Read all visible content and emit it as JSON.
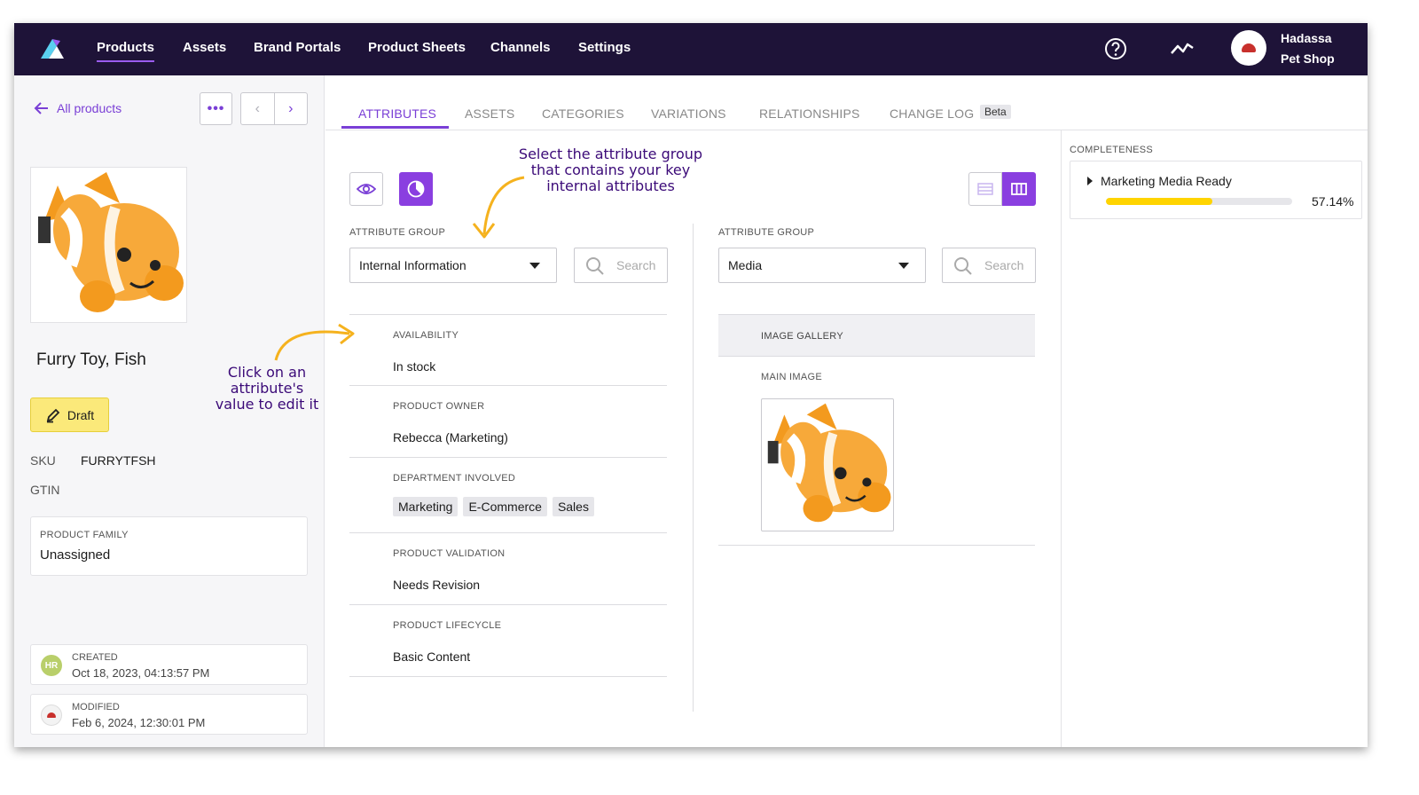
{
  "nav": {
    "items": [
      "Products",
      "Assets",
      "Brand Portals",
      "Product Sheets",
      "Channels",
      "Settings"
    ],
    "user_line1": "Hadassa",
    "user_line2": "Pet Shop"
  },
  "left": {
    "back_label": "All products",
    "more_label": "•••",
    "prev_label": "‹",
    "next_label": "›",
    "product_name": "Furry Toy, Fish",
    "status_label": "Draft",
    "sku_label": "SKU",
    "sku_value": "FURRYTFSH",
    "gtin_label": "GTIN",
    "family_label": "PRODUCT FAMILY",
    "family_value": "Unassigned",
    "created_initials": "HR",
    "created_label": "CREATED",
    "created_value": "Oct 18, 2023, 04:13:57 PM",
    "modified_label": "MODIFIED",
    "modified_value": "Feb 6, 2024, 12:30:01 PM"
  },
  "annotations": {
    "click_line1": "Click on an",
    "click_line2": "attribute's",
    "click_line3": "value to edit it",
    "select_line1": "Select the attribute group",
    "select_line2": "that contains your key",
    "select_line3": "internal attributes"
  },
  "tabs": {
    "items": [
      "ATTRIBUTES",
      "ASSETS",
      "CATEGORIES",
      "VARIATIONS",
      "RELATIONSHIPS",
      "CHANGE LOG"
    ],
    "beta": "Beta",
    "active": "ATTRIBUTES"
  },
  "left_group": {
    "label": "ATTRIBUTE GROUP",
    "selected": "Internal Information",
    "search_placeholder": "Search",
    "attributes": [
      {
        "label": "AVAILABILITY",
        "value": "In stock"
      },
      {
        "label": "PRODUCT OWNER",
        "value": "Rebecca (Marketing)"
      },
      {
        "label": "DEPARTMENT INVOLVED",
        "chips": [
          "Marketing",
          "E-Commerce",
          "Sales"
        ]
      },
      {
        "label": "PRODUCT VALIDATION",
        "value": "Needs Revision"
      },
      {
        "label": "PRODUCT LIFECYCLE",
        "value": "Basic Content"
      }
    ]
  },
  "right_group": {
    "label": "ATTRIBUTE GROUP",
    "selected": "Media",
    "search_placeholder": "Search",
    "gallery_label": "IMAGE GALLERY",
    "main_image_label": "MAIN IMAGE"
  },
  "completeness": {
    "label": "COMPLETENESS",
    "channel": "Marketing Media Ready",
    "percent_text": "57.14%",
    "fraction": 0.5714
  },
  "colors": {
    "nav_bg": "#1e1338",
    "accent": "#7a3fd6",
    "draft": "#fbe97a",
    "progress": "#ffd400",
    "annotation": "#3b0a78",
    "arrow": "#f5b21e"
  }
}
